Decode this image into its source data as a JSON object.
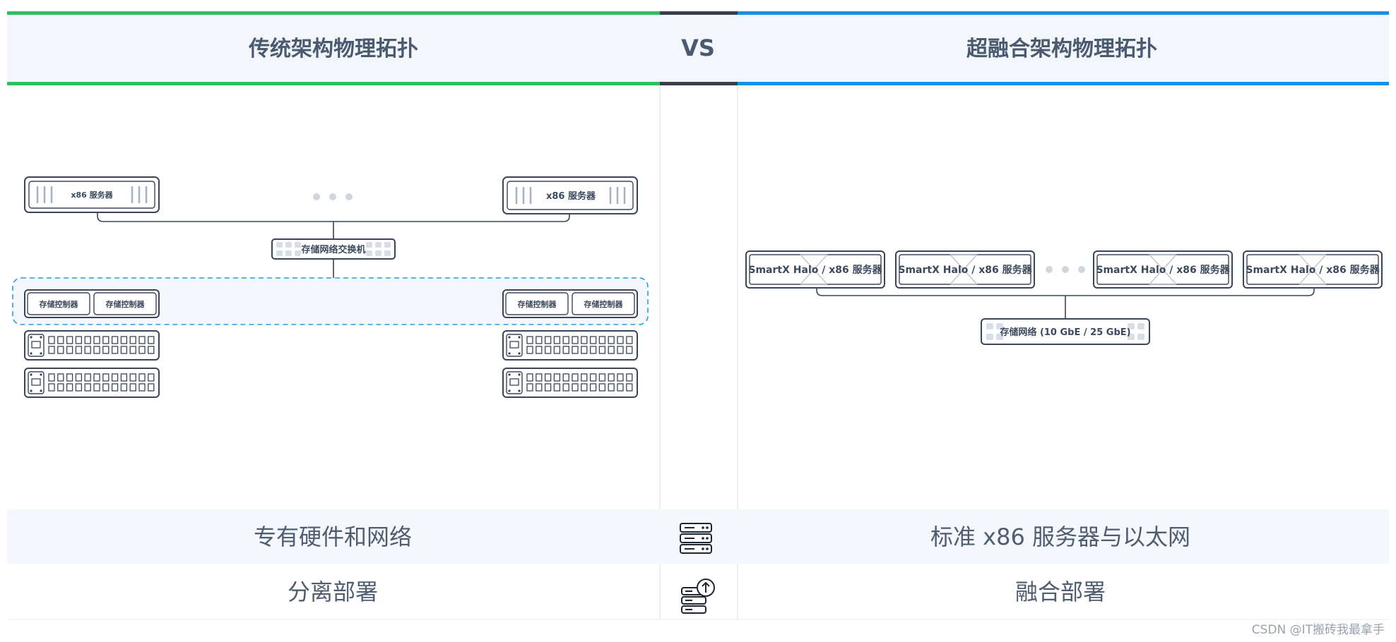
{
  "header": {
    "left_title": "传统架构物理拓扑",
    "vs_label": "VS",
    "right_title": "超融合架构物理拓扑"
  },
  "colors": {
    "left_accent": "#2fbf5f",
    "vs_accent": "#3a3f4b",
    "right_accent": "#1493e6",
    "header_bg": "#f3f6fa",
    "row_bg": "#f4f7fb",
    "dashed_group": "#2a9be0"
  },
  "traditional": {
    "server_left_label": "x86 服务器",
    "server_right_label": "x86 服务器",
    "switch_label": "存储网络交换机",
    "controllers": [
      "存储控制器",
      "存储控制器",
      "存储控制器",
      "存储控制器"
    ]
  },
  "hyperconverged": {
    "nodes": [
      "SmartX Halo / x86 服务器",
      "SmartX Halo / x86 服务器",
      "SmartX Halo / x86 服务器",
      "SmartX Halo / x86 服务器"
    ],
    "switch_label": "存储网络 (10 GbE / 25 GbE)"
  },
  "comparison_rows": [
    {
      "left": "专有硬件和网络",
      "icon": "server-rack-icon",
      "right": "标准 x86 服务器与以太网"
    },
    {
      "left": "分离部署",
      "icon": "server-upload-icon",
      "right": "融合部署"
    }
  ],
  "watermark": "CSDN @IT搬砖我最拿手"
}
